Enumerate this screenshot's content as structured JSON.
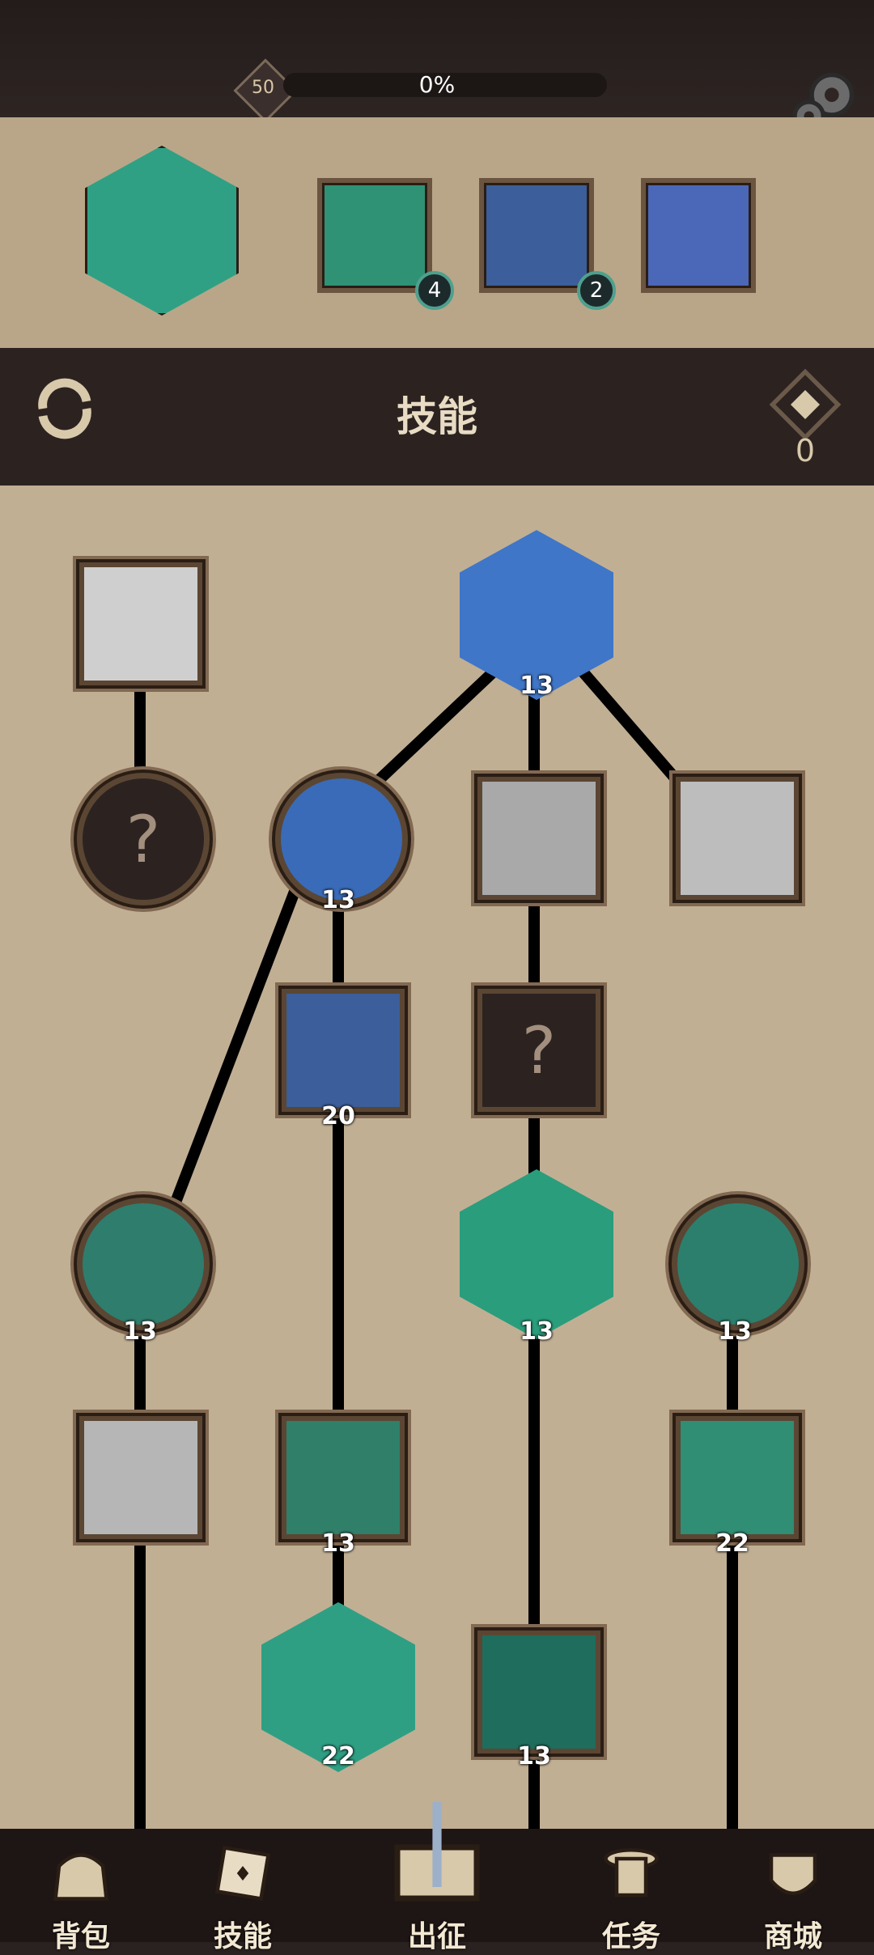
{
  "header": {
    "level": "50",
    "xp_percent_label": "0%",
    "xp_fraction": 0.0,
    "settings_icon": "gear-icon"
  },
  "equipped_skills": [
    {
      "name": "slot-main",
      "badge": null,
      "color": "#2fa084"
    },
    {
      "name": "slot-2",
      "badge": "4",
      "color": "#2f9275"
    },
    {
      "name": "slot-3",
      "badge": "2",
      "color": "#3c5e9a"
    },
    {
      "name": "slot-4",
      "badge": null,
      "color": "#4b67b8"
    }
  ],
  "skills_section": {
    "title": "技能",
    "points": "0",
    "refresh_icon": "refresh-icon"
  },
  "tree": {
    "nodes": [
      {
        "id": "n1",
        "shape": "sq",
        "level": null,
        "color": "#cfcfcf"
      },
      {
        "id": "n2",
        "shape": "circ",
        "level": null,
        "locked": true
      },
      {
        "id": "n3",
        "shape": "hex",
        "level": "13",
        "color": "#3f76c7"
      },
      {
        "id": "n4",
        "shape": "circ",
        "level": "13",
        "color": "#3a6bb8"
      },
      {
        "id": "n5",
        "shape": "sq",
        "level": null,
        "color": "#a9a9a9"
      },
      {
        "id": "n6",
        "shape": "sq",
        "level": null,
        "color": "#bdbdbd"
      },
      {
        "id": "n7",
        "shape": "sq",
        "level": "20",
        "color": "#3c5e9a"
      },
      {
        "id": "n8",
        "shape": "sq",
        "level": null,
        "locked": true
      },
      {
        "id": "n9",
        "shape": "circ",
        "level": "13",
        "color": "#2f7d6d"
      },
      {
        "id": "n10",
        "shape": "hex",
        "level": "13",
        "color": "#2a9d7c"
      },
      {
        "id": "n11",
        "shape": "circ",
        "level": "13",
        "color": "#2c7f6d"
      },
      {
        "id": "n12",
        "shape": "sq",
        "level": null,
        "color": "#b6b6b6"
      },
      {
        "id": "n13",
        "shape": "sq",
        "level": "13",
        "color": "#2f7f69"
      },
      {
        "id": "n14",
        "shape": "sq",
        "level": "22",
        "color": "#2f8e74"
      },
      {
        "id": "n15",
        "shape": "hex",
        "level": "22",
        "color": "#2f9f84"
      },
      {
        "id": "n16",
        "shape": "sq",
        "level": "13",
        "color": "#1f6d5c"
      }
    ],
    "locked_symbol": "?"
  },
  "bottom_nav": [
    {
      "label": "背包",
      "icon": "bag-icon"
    },
    {
      "label": "技能",
      "icon": "skill-book-icon"
    },
    {
      "label": "出征",
      "icon": "sword-map-icon"
    },
    {
      "label": "任务",
      "icon": "scroll-icon"
    },
    {
      "label": "商城",
      "icon": "shop-icon"
    }
  ]
}
